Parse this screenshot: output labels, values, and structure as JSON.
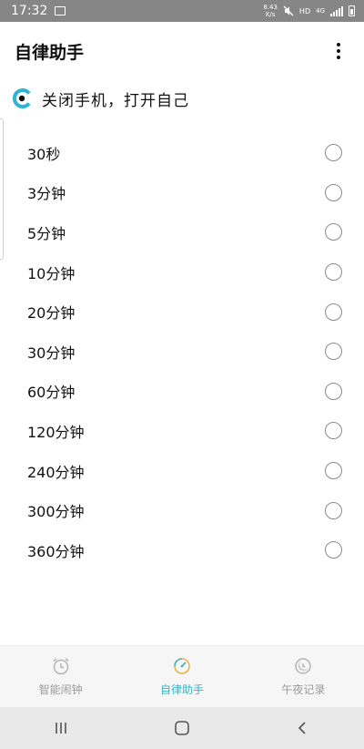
{
  "status_bar": {
    "time": "17:32",
    "speed_value": "8.43",
    "speed_unit": "K/s",
    "hd": "HD",
    "network": "4G"
  },
  "app_bar": {
    "title": "自律助手"
  },
  "slogan": {
    "text": "关闭手机，打开自己"
  },
  "durations": [
    {
      "label": "30秒",
      "selected": false
    },
    {
      "label": "3分钟",
      "selected": false
    },
    {
      "label": "5分钟",
      "selected": false
    },
    {
      "label": "10分钟",
      "selected": false
    },
    {
      "label": "20分钟",
      "selected": false
    },
    {
      "label": "30分钟",
      "selected": false
    },
    {
      "label": "60分钟",
      "selected": false
    },
    {
      "label": "120分钟",
      "selected": false
    },
    {
      "label": "240分钟",
      "selected": false
    },
    {
      "label": "300分钟",
      "selected": false
    },
    {
      "label": "360分钟",
      "selected": false
    }
  ],
  "bottom_nav": {
    "items": [
      {
        "label": "智能闹钟",
        "icon": "alarm-clock-icon",
        "active": false
      },
      {
        "label": "自律助手",
        "icon": "gauge-icon",
        "active": true
      },
      {
        "label": "午夜记录",
        "icon": "moon-clock-icon",
        "active": false
      }
    ]
  },
  "colors": {
    "accent": "#35b6c8",
    "inactive": "#9a9a9a",
    "status_bar": "#868686"
  }
}
